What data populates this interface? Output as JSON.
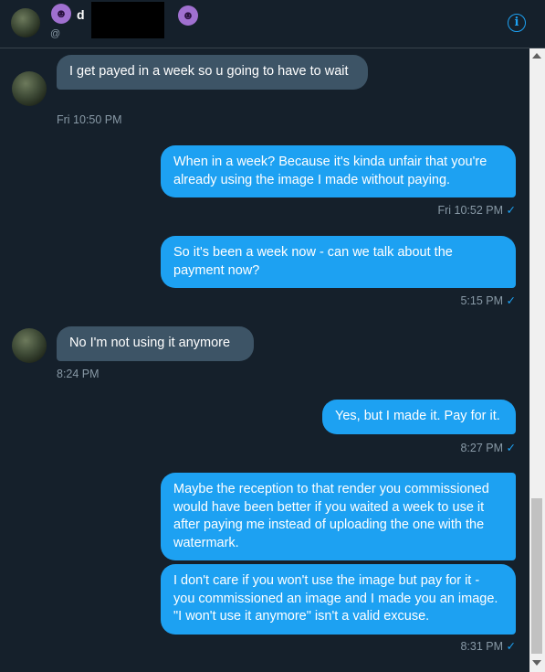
{
  "header": {
    "name_visible": "d",
    "handle_visible": "@",
    "emoji_icon": "smiling-imp-emoji",
    "info_icon": "i"
  },
  "messages": [
    {
      "direction": "incoming",
      "text": "I get payed in a week so u going to have to wait",
      "time": "Fri 10:50 PM"
    },
    {
      "direction": "outgoing",
      "text": "When in a week? Because it's kinda unfair that you're already using the image I made without paying.",
      "time": "Fri 10:52 PM",
      "status": "✓"
    },
    {
      "direction": "outgoing",
      "text": "So it's been a week now - can we talk about the payment now?",
      "time": "5:15 PM",
      "status": "✓"
    },
    {
      "direction": "incoming",
      "text": "No I'm not using it anymore",
      "time": "8:24 PM"
    },
    {
      "direction": "outgoing",
      "text": "Yes, but I made it. Pay for it.",
      "time": "8:27 PM",
      "status": "✓"
    },
    {
      "direction": "outgoing",
      "text": "Maybe the reception to that render you commissioned would have been better if you waited a week to use it after paying me instead of uploading the one with the watermark."
    },
    {
      "direction": "outgoing",
      "text": "I don't care if you won't use the image but pay for it - you commissioned an image and I made you an image. \"I won't use it anymore\" isn't a valid excuse.",
      "time": "8:31 PM",
      "status": "✓"
    }
  ],
  "colors": {
    "background": "#15202b",
    "incoming_bubble": "#3d5466",
    "outgoing_bubble": "#1da1f2",
    "meta_text": "#8899a6"
  }
}
